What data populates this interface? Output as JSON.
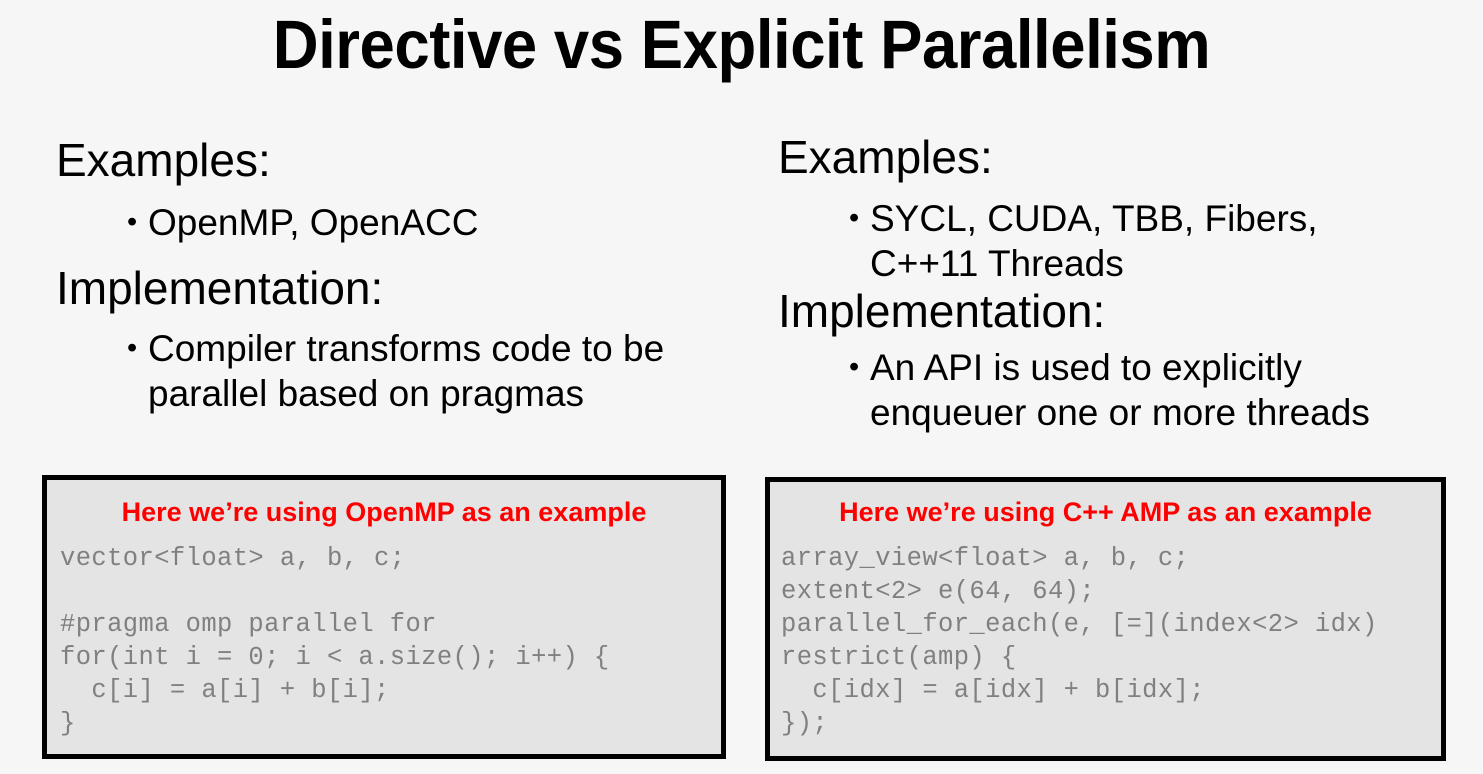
{
  "slide": {
    "title": "Directive vs Explicit Parallelism",
    "background_color": "#f6f6f6",
    "accent_color": "#fe0000",
    "code_bg_color": "#e4e4e4",
    "code_text_color": "#808080"
  },
  "left_column": {
    "examples_heading": "Examples:",
    "examples_bullet": "OpenMP, OpenACC",
    "implementation_heading": "Implementation:",
    "implementation_bullet": "Compiler transforms code to be parallel based on pragmas",
    "bullet_glyph": "•"
  },
  "right_column": {
    "examples_heading": "Examples:",
    "examples_bullet": "SYCL, CUDA, TBB, Fibers, C++11 Threads",
    "implementation_heading": "Implementation:",
    "implementation_bullet": "An API is used to explicitly enqueuer one or more threads",
    "bullet_glyph": "•"
  },
  "left_code_box": {
    "caption": "Here we’re using OpenMP as an example",
    "code": "vector<float> a, b, c;\n\n#pragma omp parallel for\nfor(int i = 0; i < a.size(); i++) {\n  c[i] = a[i] + b[i];\n}"
  },
  "right_code_box": {
    "caption": "Here we’re using C++ AMP as an example",
    "code": "array_view<float> a, b, c;\nextent<2> e(64, 64);\nparallel_for_each(e, [=](index<2> idx)\nrestrict(amp) {\n  c[idx] = a[idx] + b[idx];\n});"
  }
}
